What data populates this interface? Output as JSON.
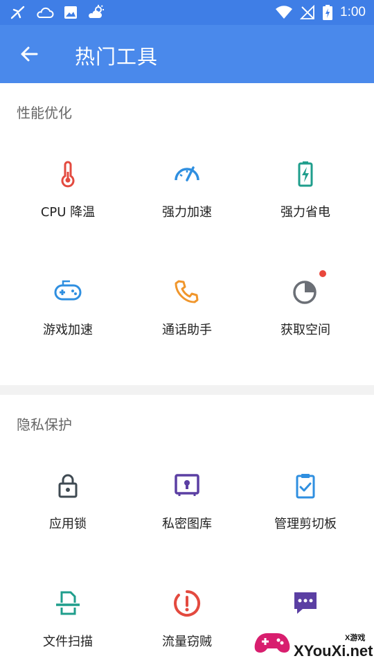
{
  "status_bar": {
    "time": "1:00"
  },
  "app_bar": {
    "title": "热门工具"
  },
  "sections": [
    {
      "title": "性能优化",
      "items": [
        {
          "label": "CPU 降温",
          "icon": "thermometer-icon",
          "color": "#e34a3f"
        },
        {
          "label": "强力加速",
          "icon": "speedometer-icon",
          "color": "#2f8fe0"
        },
        {
          "label": "强力省电",
          "icon": "battery-charging-icon",
          "color": "#1f9e8c"
        },
        {
          "label": "游戏加速",
          "icon": "gamepad-icon",
          "color": "#2f8fe0"
        },
        {
          "label": "通话助手",
          "icon": "phone-icon",
          "color": "#f0962c"
        },
        {
          "label": "获取空间",
          "icon": "pie-chart-icon",
          "color": "#6b6f76",
          "badge": "#e9473c"
        }
      ]
    },
    {
      "title": "隐私保护",
      "items": [
        {
          "label": "应用锁",
          "icon": "lock-icon",
          "color": "#3f4a52"
        },
        {
          "label": "私密图库",
          "icon": "gallery-safe-icon",
          "color": "#5b3fa3"
        },
        {
          "label": "管理剪切板",
          "icon": "clipboard-check-icon",
          "color": "#2f8fe0"
        },
        {
          "label": "文件扫描",
          "icon": "file-scan-icon",
          "color": "#1f9e8c"
        },
        {
          "label": "流量窃贼",
          "icon": "data-alert-icon",
          "color": "#e34a3f"
        },
        {
          "label": "",
          "icon": "message-icon",
          "color": "#5b3fa3"
        }
      ]
    }
  ],
  "watermark": {
    "top": "X游戏",
    "main": "XYouXi.net"
  }
}
